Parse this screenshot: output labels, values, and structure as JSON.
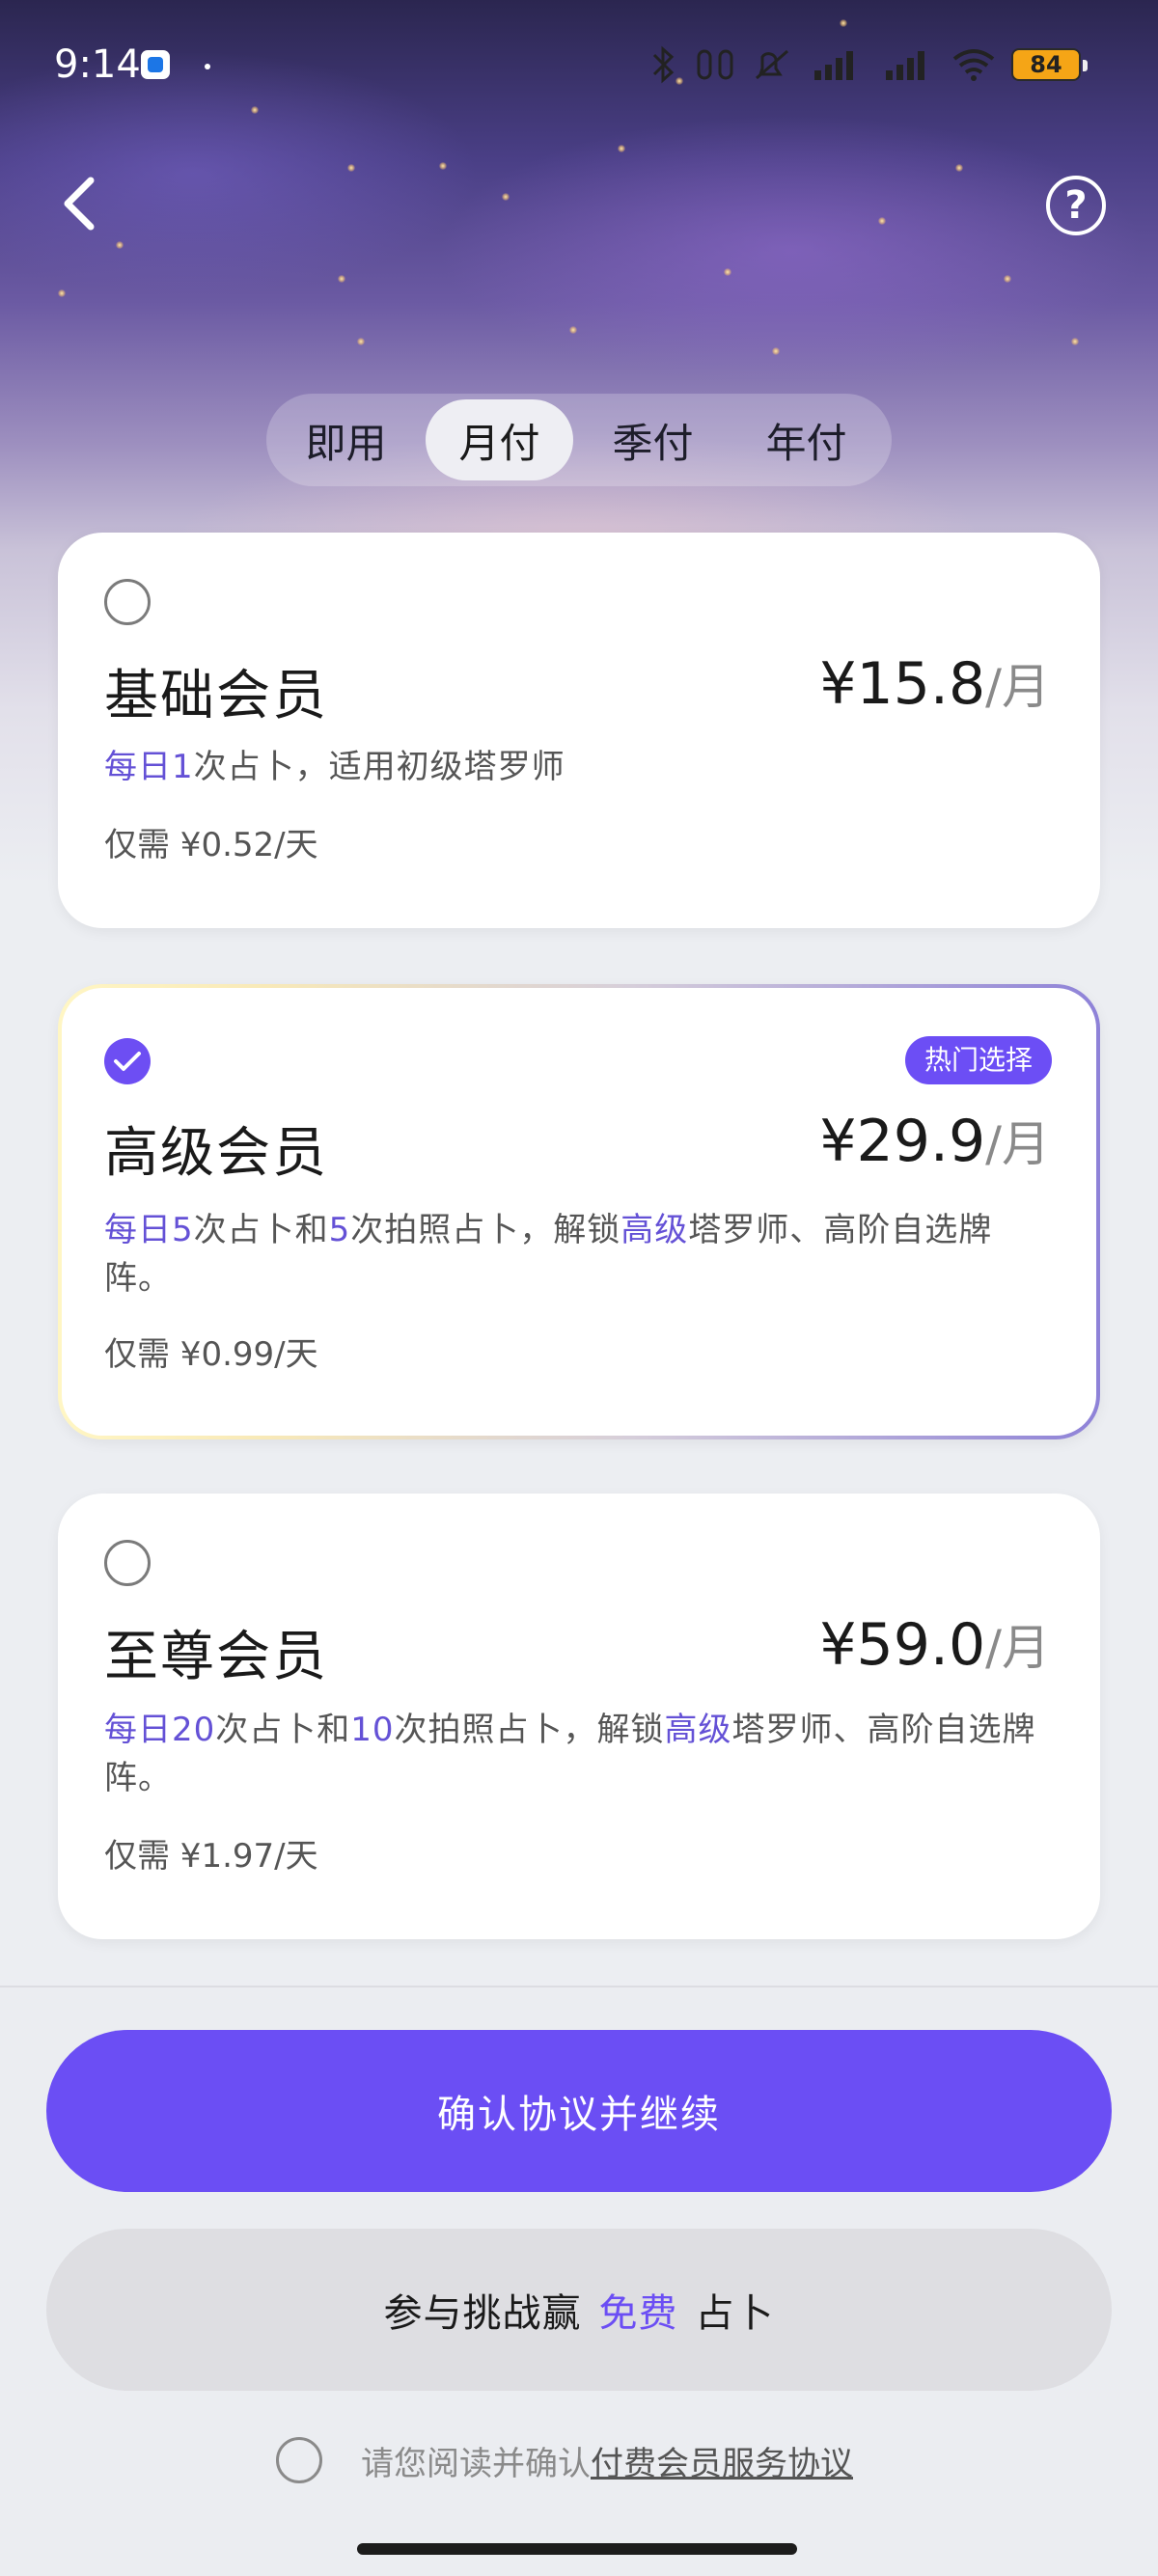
{
  "status_bar": {
    "time": "9:14",
    "battery": "84"
  },
  "header": {
    "back_icon": "chevron-left-icon",
    "help_label": "?"
  },
  "tabs": [
    {
      "label": "即用",
      "active": false
    },
    {
      "label": "月付",
      "active": true
    },
    {
      "label": "季付",
      "active": false
    },
    {
      "label": "年付",
      "active": false
    }
  ],
  "plans": [
    {
      "name": "基础会员",
      "price": "¥15.8",
      "unit": "/月",
      "selected": false,
      "desc": [
        {
          "t": "每日1",
          "hl": true
        },
        {
          "t": "次占卜，适用初级塔罗师",
          "hl": false
        }
      ],
      "daily": "仅需 ¥0.52/天"
    },
    {
      "name": "高级会员",
      "price": "¥29.9",
      "unit": "/月",
      "selected": true,
      "badge": "热门选择",
      "desc": [
        {
          "t": "每日5",
          "hl": true
        },
        {
          "t": "次占卜和",
          "hl": false
        },
        {
          "t": "5",
          "hl": true
        },
        {
          "t": "次拍照占卜，解锁",
          "hl": false
        },
        {
          "t": "高级",
          "hl": true
        },
        {
          "t": "塔罗师、高阶自选牌阵。",
          "hl": false
        }
      ],
      "daily": "仅需 ¥0.99/天"
    },
    {
      "name": "至尊会员",
      "price": "¥59.0",
      "unit": "/月",
      "selected": false,
      "desc": [
        {
          "t": "每日20",
          "hl": true
        },
        {
          "t": "次占卜和",
          "hl": false
        },
        {
          "t": "10",
          "hl": true
        },
        {
          "t": "次拍照占卜，解锁",
          "hl": false
        },
        {
          "t": "高级",
          "hl": true
        },
        {
          "t": "塔罗师、高阶自选牌阵。",
          "hl": false
        }
      ],
      "daily": "仅需 ¥1.97/天"
    }
  ],
  "actions": {
    "confirm_label": "确认协议并继续",
    "challenge_prefix": "参与挑战赢",
    "challenge_free": "免费",
    "challenge_suffix": "占卜"
  },
  "agreement": {
    "text": "请您阅读并确认",
    "link": "付费会员服务协议"
  },
  "colors": {
    "accent": "#6b4ef4",
    "highlight_text": "#6451d6"
  }
}
